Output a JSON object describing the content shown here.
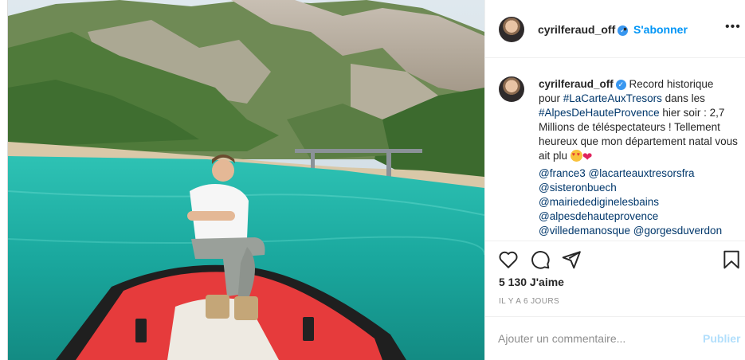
{
  "post": {
    "username": "cyrilferaud_off",
    "verified_symbol": "✓",
    "separator": "•",
    "follow_label": "S'abonner",
    "more_label": "•••"
  },
  "caption": {
    "username": "cyrilferaud_off",
    "text_1": "Record historique pour ",
    "hashtag_1": "#LaCarteAuxTresors",
    "text_2": " dans les ",
    "hashtag_2": "#AlpesDeHauteProvence",
    "text_3": " hier soir : 2,7 Millions de téléspectateurs ! Tellement heureux que mon département natal vous ait plu ",
    "heart": "❤",
    "mentions": [
      "@france3",
      "@lacarteauxtresorsfra",
      "@sisteronbuech",
      "@mairiedediginelesbains",
      "@alpesdehauteprovence",
      "@villedemanosque",
      "@gorgesduverdon"
    ]
  },
  "stats": {
    "likes": "5 130 J'aime",
    "time": "IL Y A 6 JOURS"
  },
  "comment": {
    "placeholder": "Ajouter un commentaire...",
    "publish_label": "Publier"
  },
  "icons": [
    "heart-icon",
    "comment-icon",
    "share-icon",
    "bookmark-icon",
    "verified-icon"
  ]
}
